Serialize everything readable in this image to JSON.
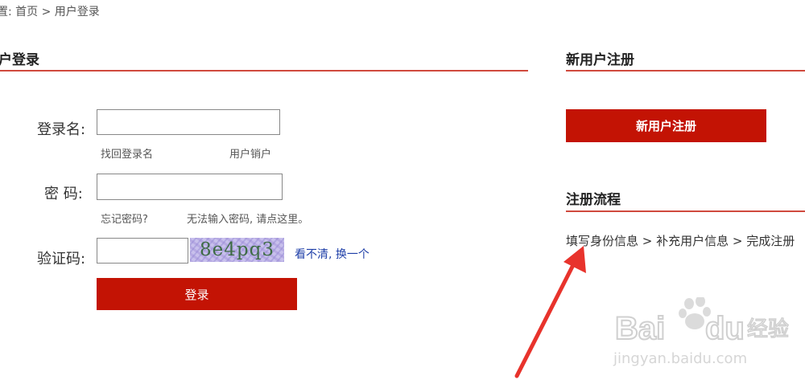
{
  "breadcrumb": {
    "text": "置: 首页 > 用户登录"
  },
  "login": {
    "title": "户登录",
    "username_label": "登录名:",
    "username_value": "",
    "password_label": "密  码:",
    "password_value": "",
    "captcha_label": "验证码:",
    "captcha_value": "",
    "captcha_text": "8e4pq3",
    "find_username": "找回登录名",
    "cancel_user": "用户销户",
    "forgot_password": "忘记密码?",
    "cannot_input": "无法输入密码, 请点这里。",
    "refresh_captcha": "看不清, 换一个",
    "submit": "登录"
  },
  "register": {
    "title": "新用户注册",
    "button": "新用户注册",
    "process_title": "注册流程",
    "process_steps": "填写身份信息 > 补充用户信息 > 完成注册"
  },
  "colors": {
    "accent": "#c31304",
    "rule": "#d04a3e",
    "link": "#1f3fa8",
    "arrow": "#e8332c"
  },
  "watermark": {
    "brand": "Bai",
    "brand2": "du",
    "cn": "经验",
    "url": "jingyan.baidu.com"
  }
}
